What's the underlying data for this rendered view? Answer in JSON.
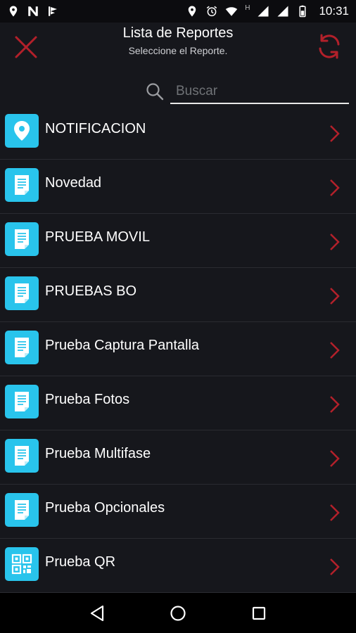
{
  "status_bar": {
    "time": "10:31",
    "network_letter": "H",
    "left_icons": [
      "location-icon",
      "n-app-icon",
      "flag-app-icon"
    ],
    "right_icons": [
      "location-icon",
      "alarm-icon",
      "wifi-icon",
      "signal-icon",
      "signal-icon",
      "battery-icon"
    ]
  },
  "header": {
    "title": "Lista de Reportes",
    "subtitle": "Seleccione el Reporte.",
    "close_icon": "close-icon",
    "refresh_icon": "refresh-icon",
    "accent_color": "#b3202a"
  },
  "search": {
    "placeholder": "Buscar",
    "value": ""
  },
  "reports": [
    {
      "label": "NOTIFICACION",
      "icon": "location-pin-icon"
    },
    {
      "label": "Novedad",
      "icon": "document-icon"
    },
    {
      "label": "PRUEBA MOVIL",
      "icon": "document-icon"
    },
    {
      "label": "PRUEBAS BO",
      "icon": "document-icon"
    },
    {
      "label": "Prueba Captura Pantalla",
      "icon": "document-icon"
    },
    {
      "label": "Prueba Fotos",
      "icon": "document-icon"
    },
    {
      "label": "Prueba Multifase",
      "icon": "document-icon"
    },
    {
      "label": "Prueba Opcionales",
      "icon": "document-icon"
    },
    {
      "label": "Prueba QR",
      "icon": "qr-code-icon"
    }
  ],
  "colors": {
    "background": "#16171c",
    "icon_tile": "#29c4ec",
    "chevron": "#b3202a"
  },
  "nav_bar": {
    "buttons": [
      "back-icon",
      "home-icon",
      "recents-icon"
    ]
  }
}
